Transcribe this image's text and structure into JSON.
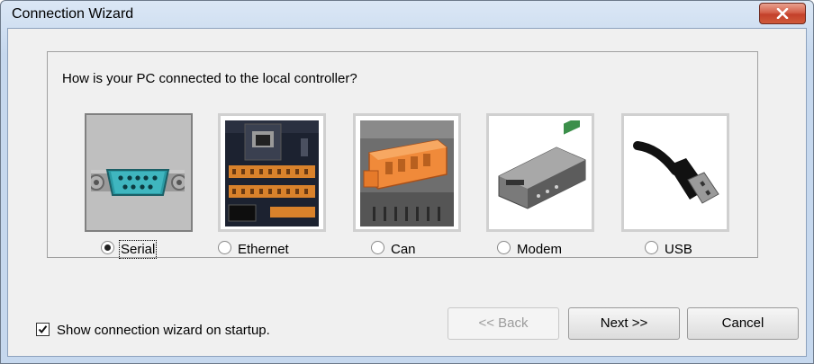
{
  "window": {
    "title": "Connection Wizard"
  },
  "group": {
    "label": "How is your PC connected to the local controller?"
  },
  "options": [
    {
      "label": "Serial",
      "selected": true,
      "picture": "serial-connector-icon"
    },
    {
      "label": "Ethernet",
      "selected": false,
      "picture": "ethernet-controller-icon"
    },
    {
      "label": "Can",
      "selected": false,
      "picture": "can-terminal-icon"
    },
    {
      "label": "Modem",
      "selected": false,
      "picture": "modem-device-icon"
    },
    {
      "label": "USB",
      "selected": false,
      "picture": "usb-plug-icon"
    }
  ],
  "startup_checkbox": {
    "label": "Show connection wizard on startup.",
    "checked": true
  },
  "buttons": {
    "back": "<< Back",
    "next": "Next >>",
    "cancel": "Cancel"
  },
  "colors": {
    "title_bg": "#c6d8ee",
    "close_button": "#c3402a",
    "dialog_bg": "#f0f0f0"
  }
}
